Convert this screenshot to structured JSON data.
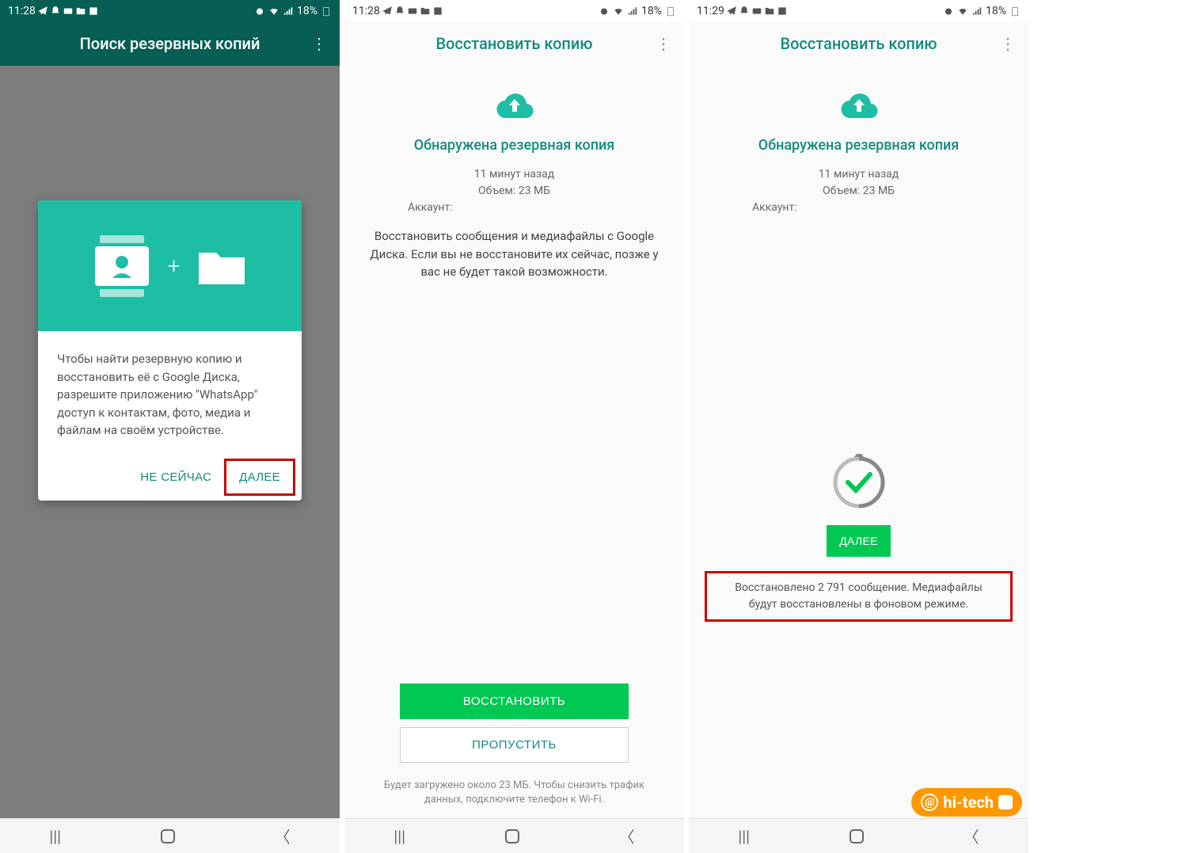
{
  "status": {
    "time1": "11:28",
    "time2": "11:28",
    "time3": "11:29",
    "battery": "18%"
  },
  "screen1": {
    "title": "Поиск резервных копий",
    "dialog_text": "Чтобы найти резервную копию и восстановить её с Google Диска, разрешите приложению \"WhatsApp\" доступ к контактам, фото, медиа и файлам на своём устройстве.",
    "btn_not_now": "НЕ СЕЙЧАС",
    "btn_next": "ДАЛЕЕ"
  },
  "screen2": {
    "title": "Восстановить копию",
    "found_title": "Обнаружена резервная копия",
    "time_ago": "11 минут назад",
    "size": "Объем: 23 МБ",
    "account_label": "Аккаунт:",
    "desc": "Восстановить сообщения и медиафайлы с Google Диска. Если вы не восстановите их сейчас, позже у вас не будет такой возможности.",
    "btn_restore": "ВОССТАНОВИТЬ",
    "btn_skip": "ПРОПУСТИТЬ",
    "footer": "Будет загружено около 23 МБ. Чтобы снизить трафик данных, подключите телефон к Wi-Fi."
  },
  "screen3": {
    "title": "Восстановить копию",
    "found_title": "Обнаружена резервная копия",
    "time_ago": "11 минут назад",
    "size": "Объем: 23 МБ",
    "account_label": "Аккаунт:",
    "btn_next": "ДАЛЕЕ",
    "restore_msg": "Восстановлено 2 791 сообщение. Медиафайлы будут восстановлены в фоновом режиме."
  },
  "watermark": "hi-tech"
}
